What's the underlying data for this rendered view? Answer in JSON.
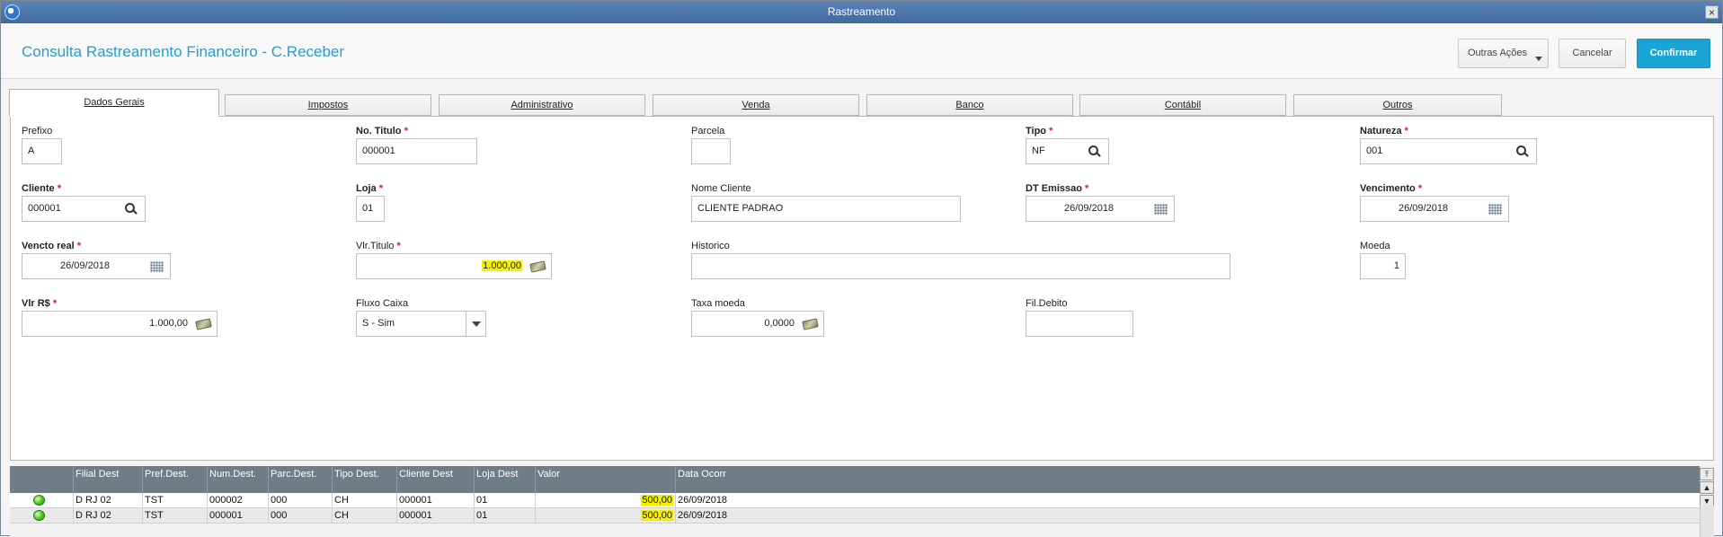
{
  "window": {
    "title": "Rastreamento",
    "close_label": "×"
  },
  "header": {
    "title": "Consulta Rastreamento Financeiro - C.Receber",
    "buttons": {
      "other_actions": "Outras Ações",
      "cancel": "Cancelar",
      "confirm": "Confirmar"
    }
  },
  "tabs": [
    "Dados Gerais",
    "Impostos",
    "Administrativo",
    "Venda",
    "Banco",
    "Contábil",
    "Outros"
  ],
  "form": {
    "prefixo": {
      "label": "Prefixo",
      "value": "A"
    },
    "no_titulo": {
      "label": "No. Titulo",
      "value": "000001"
    },
    "parcela": {
      "label": "Parcela",
      "value": ""
    },
    "tipo": {
      "label": "Tipo",
      "value": "NF"
    },
    "natureza": {
      "label": "Natureza",
      "value": "001"
    },
    "cliente": {
      "label": "Cliente",
      "value": "000001"
    },
    "loja": {
      "label": "Loja",
      "value": "01"
    },
    "nome_cliente": {
      "label": "Nome Cliente",
      "value": "CLIENTE PADRAO"
    },
    "dt_emissao": {
      "label": "DT Emissao",
      "value": "26/09/2018"
    },
    "vencimento": {
      "label": "Vencimento",
      "value": "26/09/2018"
    },
    "vencto_real": {
      "label": "Vencto real",
      "value": "26/09/2018"
    },
    "vlr_titulo": {
      "label": "Vlr.Titulo",
      "value": "1.000,00"
    },
    "historico": {
      "label": "Historico",
      "value": ""
    },
    "moeda": {
      "label": "Moeda",
      "value": "1"
    },
    "vlr_rs": {
      "label": "Vlr R$",
      "value": "1.000,00"
    },
    "fluxo_caixa": {
      "label": "Fluxo Caixa",
      "value": "S - Sim"
    },
    "taxa_moeda": {
      "label": "Taxa moeda",
      "value": "0,0000"
    },
    "fil_debito": {
      "label": "Fil.Debito",
      "value": ""
    },
    "required_mark": "*"
  },
  "grid": {
    "columns": [
      "Filial Dest",
      "Pref.Dest.",
      "Num.Dest.",
      "Parc.Dest.",
      "Tipo Dest.",
      "Cliente Dest",
      "Loja Dest",
      "Valor",
      "Data Ocorr"
    ],
    "rows": [
      [
        "D RJ 02",
        "TST",
        "000002",
        "000",
        "CH",
        "000001",
        "01",
        "500,00",
        "26/09/2018"
      ],
      [
        "D RJ 02",
        "TST",
        "000001",
        "000",
        "CH",
        "000001",
        "01",
        "500,00",
        "26/09/2018"
      ]
    ],
    "status_color": "#4bc21e"
  },
  "colors": {
    "accent": "#2a9cc9",
    "confirm": "#1aa4d5",
    "required": "#e0162b",
    "highlight": "#f5f000"
  }
}
